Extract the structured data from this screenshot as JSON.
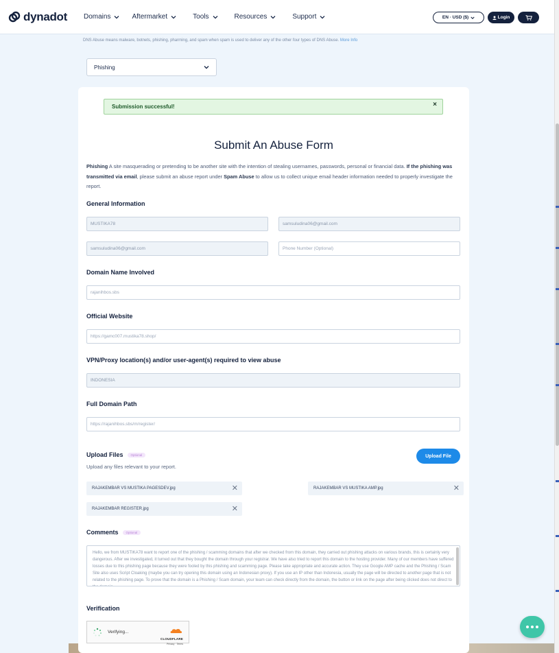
{
  "brand": {
    "name": "dynadot"
  },
  "nav": [
    {
      "label": "Domains"
    },
    {
      "label": "Aftermarket"
    },
    {
      "label": "Tools"
    },
    {
      "label": "Resources"
    },
    {
      "label": "Support"
    }
  ],
  "header": {
    "lang_currency": "EN · USD ($)",
    "login": "Login"
  },
  "dns_note": {
    "text": "DNS Abuse means malware, botnets, phishing, pharming, and spam when spam is used to deliver any of the other four types of DNS Abuse.",
    "link": "More Info"
  },
  "abuse_type_select": {
    "value": "Phishing"
  },
  "alert": {
    "text": "Submission successful!",
    "close": "×"
  },
  "form": {
    "title": "Submit An Abuse Form",
    "desc_term": "Phishing",
    "desc_text1": " A site masquerading or pretending to be another site with the intention of stealing usernames, passwords, personal or financial data. ",
    "desc_bold": "If the phishing was transmitted via email",
    "desc_text2": ", please submit an abuse report under ",
    "desc_bold2": "Spam Abuse",
    "desc_text3": " to allow us to collect unique email header information needed to properly investigate the report."
  },
  "general_info": {
    "title": "General Information",
    "name": "MUSTIKA78",
    "email": "samsuludina06@gmail.com",
    "email_confirm": "samsuludina06@gmail.com",
    "phone_placeholder": "Phone Number (Optional)"
  },
  "domain_involved": {
    "title": "Domain Name Involved",
    "value": "rajanihbos.sbs"
  },
  "official_website": {
    "title": "Official Website",
    "value": "https://gamc007.mustika78.shop/"
  },
  "vpn": {
    "title": "VPN/Proxy location(s) and/or user-agent(s) required to view abuse",
    "value": "INDONESIA"
  },
  "full_path": {
    "title": "Full Domain Path",
    "value": "https://rajanihbos.sbs/m/register/"
  },
  "upload": {
    "title": "Upload Files",
    "optional": "Optional",
    "button": "Upload File",
    "hint": "Upload any files relevant to your report.",
    "files": [
      {
        "name": "RAJAKEMBAR VS MUSTIKA PAGESDEV.jpg"
      },
      {
        "name": "RAJAKEMBAR VS MUSTIKA AMP.jpg"
      },
      {
        "name": "RAJAKEMBAR REGISTER.jpg"
      }
    ]
  },
  "comments": {
    "title": "Comments",
    "optional": "Optional",
    "text": "Hello, we from MUSTIKA78 want to report one of the phishing / scamming domains that after we checked from this domain, they carried out phishing attacks on various brands, this is certainly very dangerous. After we investigated, it turned out that they bought the domain through your registrar. We have also tried to report this domain to the hosting provider. Many of our members have suffered losses due to this phishing page because they were fooled by this phishing and scamming page. Please take appropriate and accurate action. They use Google AMP cache and the Phishing / Scam Site also uses Script Cloaking (maybe you can try opening this domain using an Indonesian proxy). If you use an IP other than Indonesia, usually the page will be directed to another page that is not related to the phishing page. To prove that the domain is a Phishing / Scam domain, your team can check directly from the domain, the button or link on the page after being clicked does not direct to the domain"
  },
  "verification": {
    "title": "Verification",
    "status": "Verifying...",
    "provider": "CLOUDFLARE",
    "links": "Privacy · Terms"
  },
  "colors": {
    "primary_dark": "#14213d",
    "accent_blue": "#1d8ae8",
    "success_bg": "#e3f6e2",
    "chat_green": "#3fc6a8"
  }
}
